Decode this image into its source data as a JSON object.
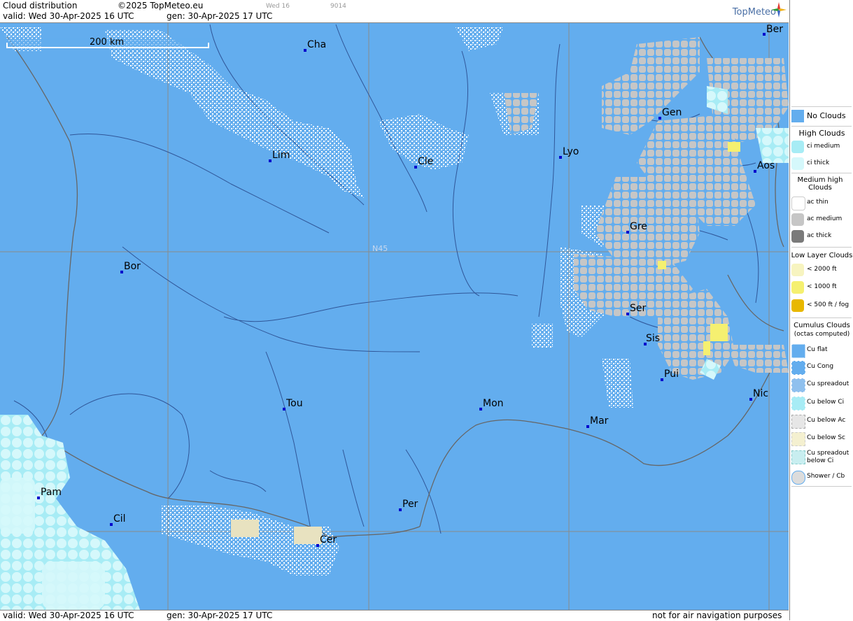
{
  "header": {
    "title": "Cloud distribution",
    "copyright": "©2025 TopMeteo.eu",
    "valid": "valid:  Wed  30-Apr-2025  16 UTC",
    "gen": "gen: 30-Apr-2025 17 UTC",
    "small_a": "Wed 16",
    "small_b": "9014",
    "logo": "TopMeteo"
  },
  "footer": {
    "valid": "valid:  Wed  30-Apr-2025  16 UTC",
    "gen": "gen: 30-Apr-2025 17 UTC",
    "disclaimer": "not for air navigation purposes"
  },
  "map": {
    "scale_label": "200 km",
    "latitude_label": "N45",
    "colors": {
      "ocean": "#63adee",
      "grid": "#8a8a8a",
      "river": "#2a4d8f",
      "border": "#666666",
      "city_marker": "#0000cc"
    },
    "cities": [
      {
        "name": "Cha"
      },
      {
        "name": "Ber"
      },
      {
        "name": "Gen"
      },
      {
        "name": "Lim"
      },
      {
        "name": "Cle"
      },
      {
        "name": "Lyo"
      },
      {
        "name": "Aos"
      },
      {
        "name": "Gre"
      },
      {
        "name": "Bor"
      },
      {
        "name": "Ser"
      },
      {
        "name": "Sis"
      },
      {
        "name": "Pui"
      },
      {
        "name": "Tou"
      },
      {
        "name": "Mon"
      },
      {
        "name": "Mar"
      },
      {
        "name": "Nic"
      },
      {
        "name": "Pam"
      },
      {
        "name": "Cil"
      },
      {
        "name": "Per"
      },
      {
        "name": "Cer"
      }
    ]
  },
  "legend": {
    "no_clouds": "No Clouds",
    "high_clouds": "High Clouds",
    "ci_medium": "ci medium",
    "ci_thick": "ci thick",
    "medium_high": "Medium high Clouds",
    "ac_thin": "ac thin",
    "ac_medium": "ac medium",
    "ac_thick": "ac thick",
    "low_layer": "Low Layer Clouds",
    "low_2000": "< 2000 ft",
    "low_1000": "< 1000 ft",
    "low_500": "< 500 ft / fog",
    "cumulus": "Cumulus Clouds",
    "cumulus_sub": "(octas computed)",
    "cu_flat": "Cu flat",
    "cu_cong": "Cu Cong",
    "cu_spreadout": "Cu spreadout",
    "cu_below_ci": "Cu below Ci",
    "cu_below_ac": "Cu below Ac",
    "cu_below_sc": "Cu below Sc",
    "cu_spreadout_below_ci": "Cu spreadout below Ci",
    "shower_cb": "Shower / Cb"
  }
}
